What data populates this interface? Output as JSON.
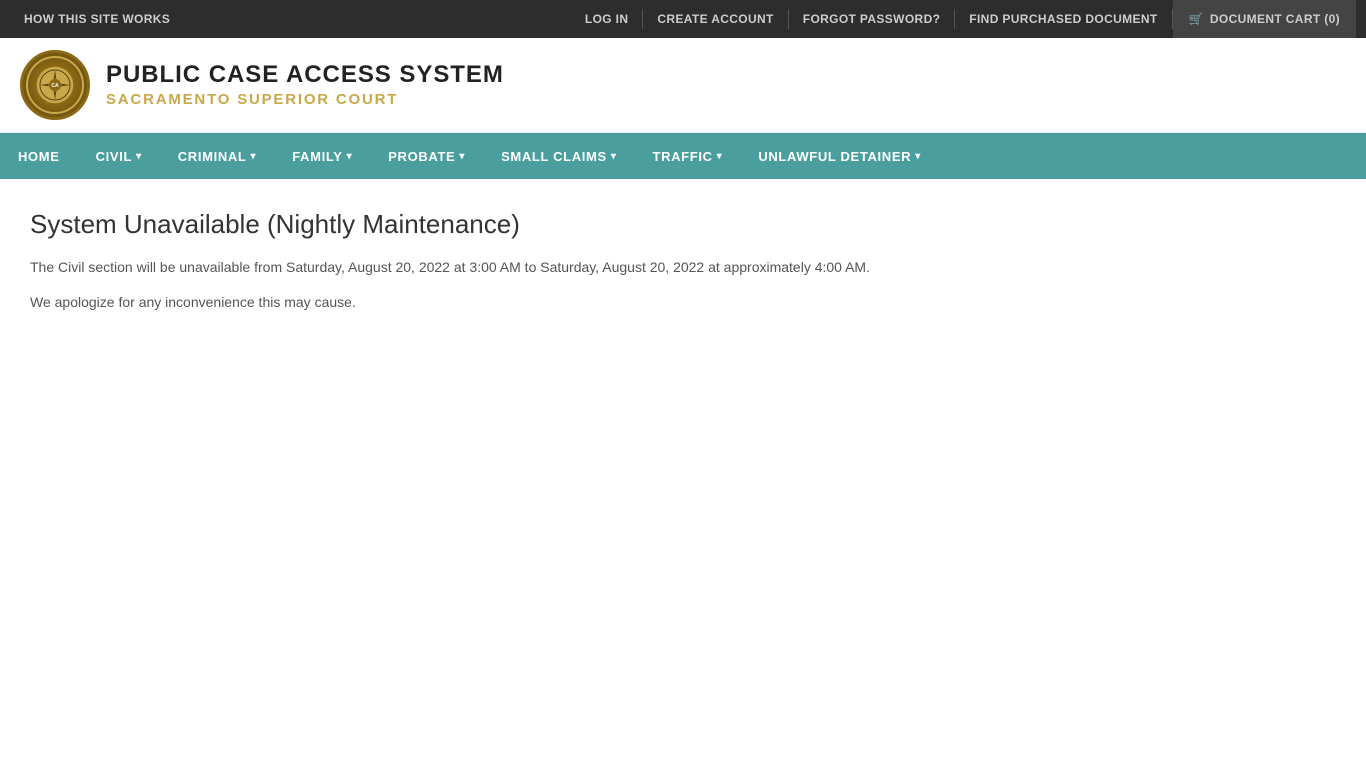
{
  "topbar": {
    "how_it_works": "HOW THIS SITE WORKS",
    "log_in": "LOG IN",
    "create_account": "CREATE ACCOUNT",
    "forgot_password": "FORGOT PASSWORD?",
    "find_document": "FIND PURCHASED DOCUMENT",
    "cart_label": "DOCUMENT CART (0)"
  },
  "header": {
    "title": "PUBLIC CASE ACCESS SYSTEM",
    "subtitle": "SACRAMENTO SUPERIOR COURT"
  },
  "nav": {
    "items": [
      {
        "label": "HOME",
        "has_dropdown": false
      },
      {
        "label": "CIVIL",
        "has_dropdown": true
      },
      {
        "label": "CRIMINAL",
        "has_dropdown": true
      },
      {
        "label": "FAMILY",
        "has_dropdown": true
      },
      {
        "label": "PROBATE",
        "has_dropdown": true
      },
      {
        "label": "SMALL CLAIMS",
        "has_dropdown": true
      },
      {
        "label": "TRAFFIC",
        "has_dropdown": true
      },
      {
        "label": "UNLAWFUL DETAINER",
        "has_dropdown": true
      }
    ]
  },
  "main": {
    "page_title": "System Unavailable (Nightly Maintenance)",
    "message1": "The Civil section will be unavailable from Saturday, August 20, 2022 at 3:00 AM to Saturday, August 20, 2022 at approximately 4:00 AM.",
    "message2": "We apologize for any inconvenience this may cause."
  },
  "seal": {
    "text": "SEAL"
  }
}
